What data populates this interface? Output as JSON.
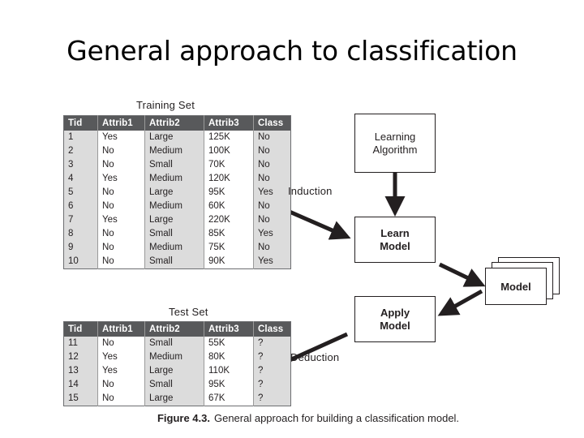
{
  "slide": {
    "title": "General approach to classification"
  },
  "figure": {
    "caption_label": "Figure 4.3.",
    "caption_text": "General approach for building a classification model."
  },
  "training_set": {
    "caption": "Training Set",
    "columns": [
      "Tid",
      "Attrib1",
      "Attrib2",
      "Attrib3",
      "Class"
    ],
    "rows": [
      [
        "1",
        "Yes",
        "Large",
        "125K",
        "No"
      ],
      [
        "2",
        "No",
        "Medium",
        "100K",
        "No"
      ],
      [
        "3",
        "No",
        "Small",
        "70K",
        "No"
      ],
      [
        "4",
        "Yes",
        "Medium",
        "120K",
        "No"
      ],
      [
        "5",
        "No",
        "Large",
        "95K",
        "Yes"
      ],
      [
        "6",
        "No",
        "Medium",
        "60K",
        "No"
      ],
      [
        "7",
        "Yes",
        "Large",
        "220K",
        "No"
      ],
      [
        "8",
        "No",
        "Small",
        "85K",
        "Yes"
      ],
      [
        "9",
        "No",
        "Medium",
        "75K",
        "No"
      ],
      [
        "10",
        "No",
        "Small",
        "90K",
        "Yes"
      ]
    ]
  },
  "test_set": {
    "caption": "Test Set",
    "columns": [
      "Tid",
      "Attrib1",
      "Attrib2",
      "Attrib3",
      "Class"
    ],
    "rows": [
      [
        "11",
        "No",
        "Small",
        "55K",
        "?"
      ],
      [
        "12",
        "Yes",
        "Medium",
        "80K",
        "?"
      ],
      [
        "13",
        "Yes",
        "Large",
        "110K",
        "?"
      ],
      [
        "14",
        "No",
        "Small",
        "95K",
        "?"
      ],
      [
        "15",
        "No",
        "Large",
        "67K",
        "?"
      ]
    ]
  },
  "flow": {
    "learning_algorithm": "Learning\nAlgorithm",
    "learning_algorithm_line1": "Learning",
    "learning_algorithm_line2": "Algorithm",
    "learn_model_line1": "Learn",
    "learn_model_line2": "Model",
    "apply_model_line1": "Apply",
    "apply_model_line2": "Model",
    "model_label": "Model",
    "induction_label": "Induction",
    "deduction_label": "Deduction"
  },
  "colors": {
    "table_header_bg": "#58595b",
    "table_header_text": "#ffffff",
    "table_shaded_col": "#dcdcdc",
    "table_plain_col": "#ffffff",
    "ink": "#231f20",
    "slide_bg": "#ffffff"
  }
}
